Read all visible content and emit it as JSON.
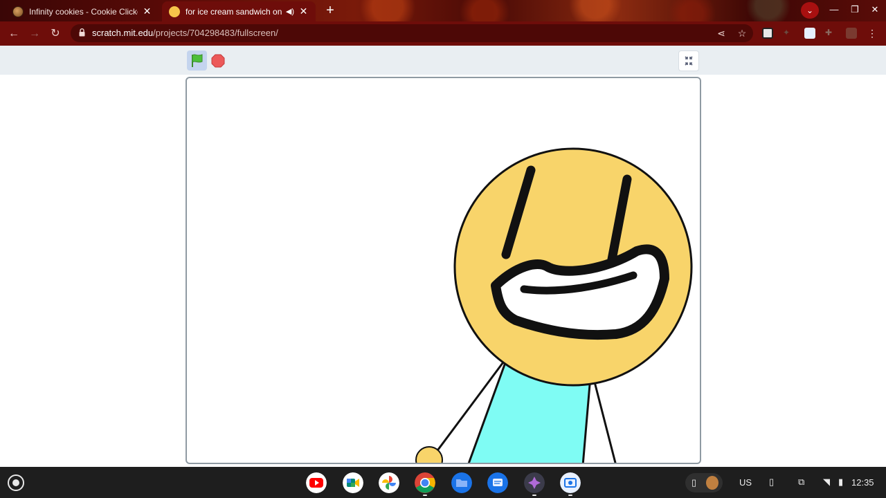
{
  "browser": {
    "tabs": [
      {
        "title": "Infinity cookies - Cookie Clicker",
        "active": false,
        "favicon": "cookie-favicon"
      },
      {
        "title": "for ice cream sandwich on S",
        "active": true,
        "favicon": "scratch-favicon",
        "audio": true
      }
    ],
    "url": {
      "domain": "scratch.mit.edu",
      "path": "/projects/704298483/fullscreen/"
    },
    "icons": [
      "back-icon",
      "forward-icon",
      "reload-icon",
      "lock-icon",
      "share-icon",
      "bookmark-star-icon",
      "menu-icon"
    ]
  },
  "scratch": {
    "controls": [
      "green-flag",
      "stop-sign",
      "exit-fullscreen"
    ]
  },
  "shelf": {
    "apps": [
      "youtube",
      "meet",
      "photos",
      "chrome",
      "files",
      "messages",
      "game",
      "screen-capture"
    ],
    "keyboard_layout": "US",
    "time": "12:35"
  },
  "colors": {
    "chrome_frame": "#6e0d0a",
    "scratch_header": "#e9eef2",
    "face": "#f8d46a",
    "shirt": "#7ffcf4"
  }
}
